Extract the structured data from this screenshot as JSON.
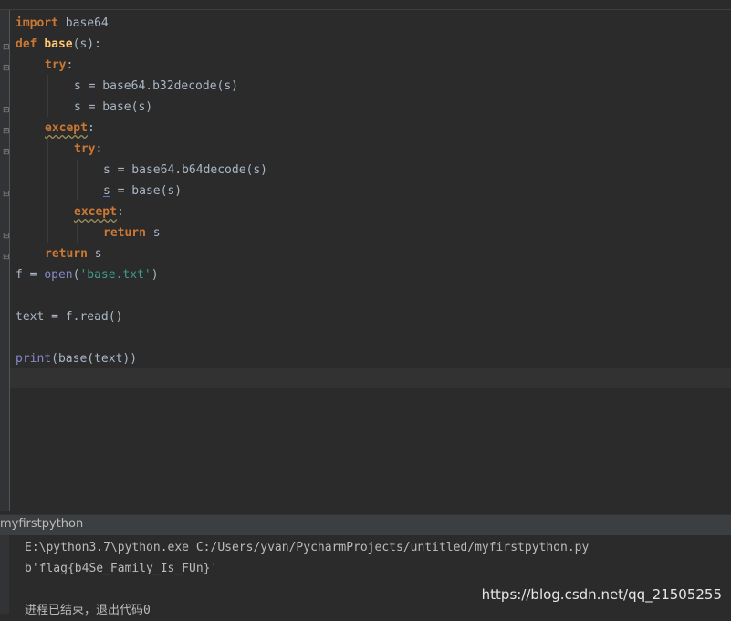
{
  "editor": {
    "lines": [
      {
        "indent": 0,
        "tokens": [
          {
            "t": "kw",
            "v": "import"
          },
          {
            "t": "op",
            "v": " base64"
          }
        ]
      },
      {
        "indent": 0,
        "tokens": [
          {
            "t": "kw",
            "v": "def"
          },
          {
            "t": "op",
            "v": " "
          },
          {
            "t": "fn",
            "v": "base"
          },
          {
            "t": "op",
            "v": "(s):"
          }
        ]
      },
      {
        "indent": 1,
        "tokens": [
          {
            "t": "kw",
            "v": "try"
          },
          {
            "t": "op",
            "v": ":"
          }
        ]
      },
      {
        "indent": 2,
        "tokens": [
          {
            "t": "op",
            "v": "s = base64.b32decode(s)"
          }
        ]
      },
      {
        "indent": 2,
        "tokens": [
          {
            "t": "op",
            "v": "s = base(s)"
          }
        ]
      },
      {
        "indent": 1,
        "tokens": [
          {
            "t": "kwwarn",
            "v": "except"
          },
          {
            "t": "op",
            "v": ":"
          }
        ]
      },
      {
        "indent": 2,
        "tokens": [
          {
            "t": "kw",
            "v": "try"
          },
          {
            "t": "op",
            "v": ":"
          }
        ]
      },
      {
        "indent": 3,
        "tokens": [
          {
            "t": "op",
            "v": "s = base64.b64decode(s)"
          }
        ]
      },
      {
        "indent": 3,
        "tokens": [
          {
            "t": "uvar",
            "v": "s"
          },
          {
            "t": "op",
            "v": " = base(s)"
          }
        ]
      },
      {
        "indent": 2,
        "tokens": [
          {
            "t": "kwwarn",
            "v": "except"
          },
          {
            "t": "op",
            "v": ":"
          }
        ]
      },
      {
        "indent": 3,
        "tokens": [
          {
            "t": "kw",
            "v": "return"
          },
          {
            "t": "op",
            "v": " s"
          }
        ]
      },
      {
        "indent": 1,
        "tokens": [
          {
            "t": "kw",
            "v": "return"
          },
          {
            "t": "op",
            "v": " s"
          }
        ]
      },
      {
        "indent": 0,
        "tokens": [
          {
            "t": "op",
            "v": "f = "
          },
          {
            "t": "bi",
            "v": "open"
          },
          {
            "t": "op",
            "v": "("
          },
          {
            "t": "strq",
            "v": "'base.txt'"
          },
          {
            "t": "op",
            "v": ")"
          }
        ]
      },
      {
        "indent": 0,
        "tokens": []
      },
      {
        "indent": 0,
        "tokens": [
          {
            "t": "op",
            "v": "text = f.read()"
          }
        ]
      },
      {
        "indent": 0,
        "tokens": []
      },
      {
        "indent": 0,
        "tokens": [
          {
            "t": "bi",
            "v": "print"
          },
          {
            "t": "op",
            "v": "(base(text))"
          }
        ]
      }
    ]
  },
  "run_panel": {
    "tab_label": "myfirstpython",
    "console_lines": [
      "E:\\python3.7\\python.exe C:/Users/yvan/PycharmProjects/untitled/myfirstpython.py",
      "b'flag{b4Se_Family_Is_FUn}'",
      "",
      "进程已结束，退出代码0"
    ]
  },
  "watermark": "https://blog.csdn.net/qq_21505255"
}
